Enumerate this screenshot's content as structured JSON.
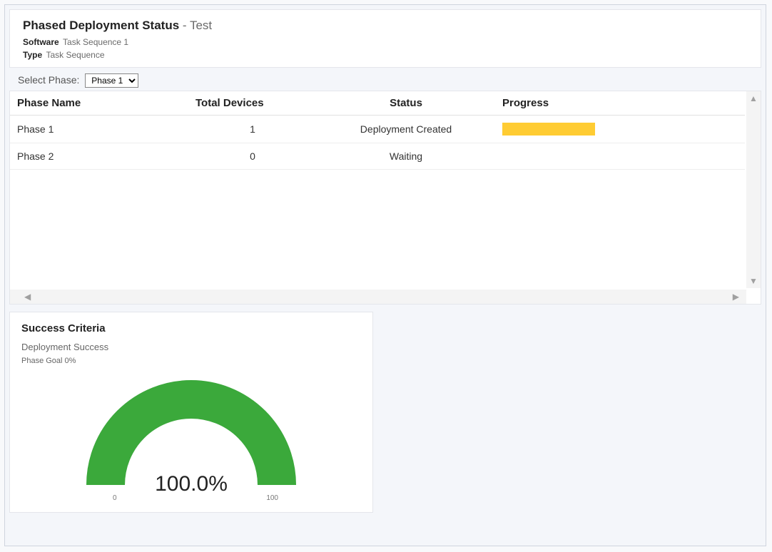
{
  "header": {
    "title": "Phased Deployment Status",
    "suffix": " - Test",
    "software_label": "Software",
    "software_value": "Task Sequence 1",
    "type_label": "Type",
    "type_value": "Task Sequence"
  },
  "selector": {
    "label": "Select Phase:",
    "selected": "Phase 1",
    "options": [
      "Phase 1",
      "Phase 2"
    ]
  },
  "table": {
    "columns": {
      "name": "Phase Name",
      "total": "Total Devices",
      "status": "Status",
      "progress": "Progress"
    },
    "rows": [
      {
        "name": "Phase 1",
        "total": "1",
        "status": "Deployment Created",
        "has_progress": true,
        "progress_color": "#ffcc33"
      },
      {
        "name": "Phase 2",
        "total": "0",
        "status": "Waiting",
        "has_progress": false
      }
    ]
  },
  "success": {
    "title": "Success Criteria",
    "subtitle": "Deployment Success",
    "goal": "Phase Goal 0%",
    "value_display": "100.0%",
    "scale_min": "0",
    "scale_max": "100"
  },
  "chart_data": {
    "type": "gauge",
    "title": "Success Criteria — Deployment Success",
    "value_percent": 100.0,
    "goal_percent": 0,
    "scale": {
      "min": 0,
      "max": 100
    },
    "color": "#3ba93b"
  }
}
